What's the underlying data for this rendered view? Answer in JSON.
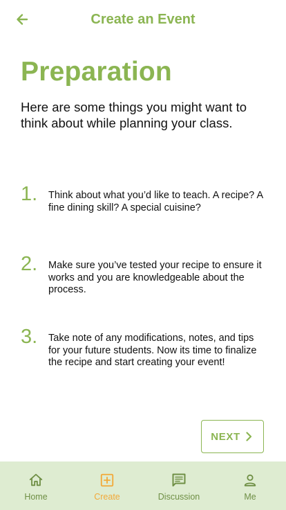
{
  "app_bar": {
    "title": "Create an Event",
    "back_icon": "arrow-left-icon"
  },
  "page": {
    "title": "Preparation",
    "intro": "Here are some things you might want to think about while planning your class."
  },
  "steps": [
    {
      "number": "1.",
      "text": "Think about what you’d like to teach. A recipe? A fine dining skill? A special cuisine?"
    },
    {
      "number": "2.",
      "text": "Make sure you’ve tested your recipe to ensure it works and you are knowledgeable about the process."
    },
    {
      "number": "3.",
      "text": "Take note of any modifications, notes, and tips for your future students. Now its time to finalize the recipe and start creating your event!"
    }
  ],
  "next_button": {
    "label": "NEXT",
    "icon": "chevron-right-icon"
  },
  "bottom_nav": {
    "items": [
      {
        "label": "Home",
        "icon": "home-icon",
        "active": false
      },
      {
        "label": "Create",
        "icon": "add-box-icon",
        "active": true
      },
      {
        "label": "Discussion",
        "icon": "chat-icon",
        "active": false
      },
      {
        "label": "Me",
        "icon": "person-icon",
        "active": false
      }
    ]
  },
  "colors": {
    "brand_green": "#8bb552",
    "nav_background": "#deecd1",
    "nav_inactive": "#6f8f45",
    "nav_active": "#f2a938",
    "text": "#111111"
  }
}
